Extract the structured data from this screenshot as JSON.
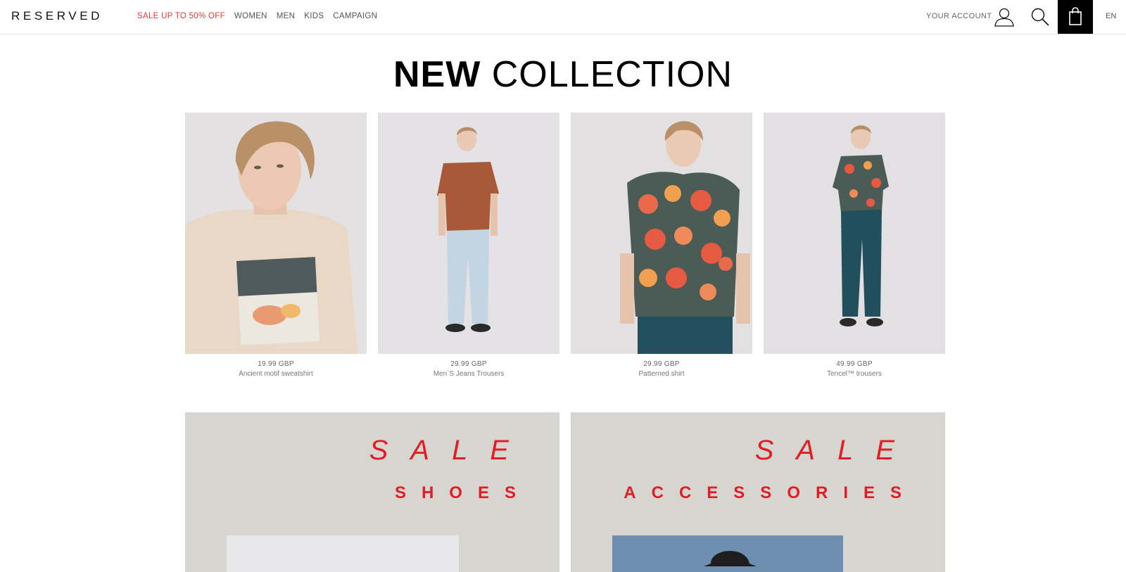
{
  "header": {
    "logo": "RESERVED",
    "nav": [
      {
        "label": "SALE UP TO 50% OFF",
        "sale": true
      },
      {
        "label": "WOMEN"
      },
      {
        "label": "MEN"
      },
      {
        "label": "KIDS"
      },
      {
        "label": "CAMPAIGN"
      }
    ],
    "account_label": "YOUR ACCOUNT",
    "lang": "EN",
    "icons": [
      "user-icon",
      "search-icon",
      "bag-icon"
    ]
  },
  "main": {
    "heading_bold": "NEW",
    "heading_thin": "COLLECTION",
    "products": [
      {
        "price": "19.99 GBP",
        "name": "Ancient motif sweatshirt"
      },
      {
        "price": "29.99 GBP",
        "name": "Men`S Jeans Trousers"
      },
      {
        "price": "29.99 GBP",
        "name": "Patterned shirt"
      },
      {
        "price": "49.99 GBP",
        "name": "Tencel™ trousers"
      }
    ],
    "banners": [
      {
        "sale": "SALE",
        "category": "SHOES"
      },
      {
        "sale": "SALE",
        "category": "ACCESSORIES"
      }
    ]
  },
  "colors": {
    "sale_red": "#e21e25",
    "nav_sale": "#e53935",
    "banner_bg": "#d6d5cf"
  }
}
